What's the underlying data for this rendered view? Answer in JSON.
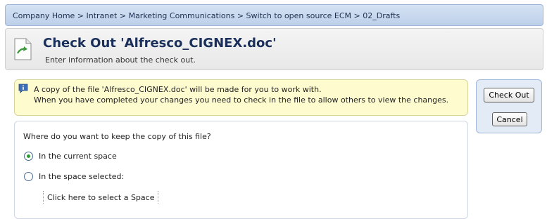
{
  "breadcrumb": {
    "path": "Company Home > Intranet > Marketing Communications > Switch to open source ECM > 02_Drafts"
  },
  "header": {
    "icon": "document-checkout-icon",
    "title": "Check Out 'Alfresco_CIGNEX.doc'",
    "subtitle": "Enter information about the check out."
  },
  "info": {
    "icon": "info-icon",
    "line1": "A copy of the file 'Alfresco_CIGNEX.doc' will be made for you to work with.",
    "line2": "When you have completed your changes you need to check in the file to allow others to view the changes."
  },
  "buttons": {
    "checkout": "Check Out",
    "cancel": "Cancel"
  },
  "form": {
    "question": "Where do you want to keep the copy of this file?",
    "options": [
      {
        "label": "In the current space",
        "selected": true
      },
      {
        "label": "In the space selected:",
        "selected": false
      }
    ],
    "select_space_link": "Click here to select a Space"
  },
  "colors": {
    "breadcrumb_bg": "#c8d9ef",
    "title": "#1a2f5a",
    "info_bg": "#fefccf",
    "radio_selected": "#2f9a2f"
  }
}
